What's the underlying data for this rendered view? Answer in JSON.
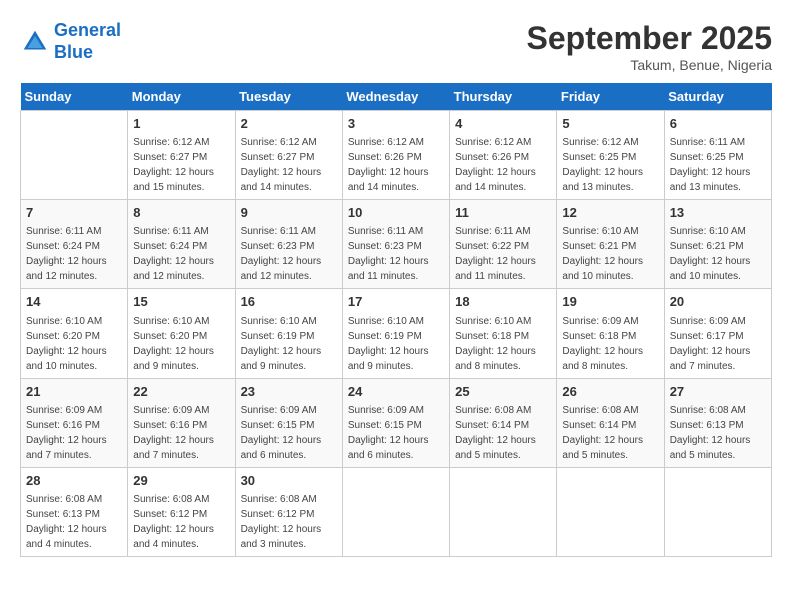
{
  "header": {
    "logo_line1": "General",
    "logo_line2": "Blue",
    "month_title": "September 2025",
    "location": "Takum, Benue, Nigeria"
  },
  "weekdays": [
    "Sunday",
    "Monday",
    "Tuesday",
    "Wednesday",
    "Thursday",
    "Friday",
    "Saturday"
  ],
  "weeks": [
    [
      {
        "day": "",
        "detail": ""
      },
      {
        "day": "1",
        "detail": "Sunrise: 6:12 AM\nSunset: 6:27 PM\nDaylight: 12 hours\nand 15 minutes."
      },
      {
        "day": "2",
        "detail": "Sunrise: 6:12 AM\nSunset: 6:27 PM\nDaylight: 12 hours\nand 14 minutes."
      },
      {
        "day": "3",
        "detail": "Sunrise: 6:12 AM\nSunset: 6:26 PM\nDaylight: 12 hours\nand 14 minutes."
      },
      {
        "day": "4",
        "detail": "Sunrise: 6:12 AM\nSunset: 6:26 PM\nDaylight: 12 hours\nand 14 minutes."
      },
      {
        "day": "5",
        "detail": "Sunrise: 6:12 AM\nSunset: 6:25 PM\nDaylight: 12 hours\nand 13 minutes."
      },
      {
        "day": "6",
        "detail": "Sunrise: 6:11 AM\nSunset: 6:25 PM\nDaylight: 12 hours\nand 13 minutes."
      }
    ],
    [
      {
        "day": "7",
        "detail": "Sunrise: 6:11 AM\nSunset: 6:24 PM\nDaylight: 12 hours\nand 12 minutes."
      },
      {
        "day": "8",
        "detail": "Sunrise: 6:11 AM\nSunset: 6:24 PM\nDaylight: 12 hours\nand 12 minutes."
      },
      {
        "day": "9",
        "detail": "Sunrise: 6:11 AM\nSunset: 6:23 PM\nDaylight: 12 hours\nand 12 minutes."
      },
      {
        "day": "10",
        "detail": "Sunrise: 6:11 AM\nSunset: 6:23 PM\nDaylight: 12 hours\nand 11 minutes."
      },
      {
        "day": "11",
        "detail": "Sunrise: 6:11 AM\nSunset: 6:22 PM\nDaylight: 12 hours\nand 11 minutes."
      },
      {
        "day": "12",
        "detail": "Sunrise: 6:10 AM\nSunset: 6:21 PM\nDaylight: 12 hours\nand 10 minutes."
      },
      {
        "day": "13",
        "detail": "Sunrise: 6:10 AM\nSunset: 6:21 PM\nDaylight: 12 hours\nand 10 minutes."
      }
    ],
    [
      {
        "day": "14",
        "detail": "Sunrise: 6:10 AM\nSunset: 6:20 PM\nDaylight: 12 hours\nand 10 minutes."
      },
      {
        "day": "15",
        "detail": "Sunrise: 6:10 AM\nSunset: 6:20 PM\nDaylight: 12 hours\nand 9 minutes."
      },
      {
        "day": "16",
        "detail": "Sunrise: 6:10 AM\nSunset: 6:19 PM\nDaylight: 12 hours\nand 9 minutes."
      },
      {
        "day": "17",
        "detail": "Sunrise: 6:10 AM\nSunset: 6:19 PM\nDaylight: 12 hours\nand 9 minutes."
      },
      {
        "day": "18",
        "detail": "Sunrise: 6:10 AM\nSunset: 6:18 PM\nDaylight: 12 hours\nand 8 minutes."
      },
      {
        "day": "19",
        "detail": "Sunrise: 6:09 AM\nSunset: 6:18 PM\nDaylight: 12 hours\nand 8 minutes."
      },
      {
        "day": "20",
        "detail": "Sunrise: 6:09 AM\nSunset: 6:17 PM\nDaylight: 12 hours\nand 7 minutes."
      }
    ],
    [
      {
        "day": "21",
        "detail": "Sunrise: 6:09 AM\nSunset: 6:16 PM\nDaylight: 12 hours\nand 7 minutes."
      },
      {
        "day": "22",
        "detail": "Sunrise: 6:09 AM\nSunset: 6:16 PM\nDaylight: 12 hours\nand 7 minutes."
      },
      {
        "day": "23",
        "detail": "Sunrise: 6:09 AM\nSunset: 6:15 PM\nDaylight: 12 hours\nand 6 minutes."
      },
      {
        "day": "24",
        "detail": "Sunrise: 6:09 AM\nSunset: 6:15 PM\nDaylight: 12 hours\nand 6 minutes."
      },
      {
        "day": "25",
        "detail": "Sunrise: 6:08 AM\nSunset: 6:14 PM\nDaylight: 12 hours\nand 5 minutes."
      },
      {
        "day": "26",
        "detail": "Sunrise: 6:08 AM\nSunset: 6:14 PM\nDaylight: 12 hours\nand 5 minutes."
      },
      {
        "day": "27",
        "detail": "Sunrise: 6:08 AM\nSunset: 6:13 PM\nDaylight: 12 hours\nand 5 minutes."
      }
    ],
    [
      {
        "day": "28",
        "detail": "Sunrise: 6:08 AM\nSunset: 6:13 PM\nDaylight: 12 hours\nand 4 minutes."
      },
      {
        "day": "29",
        "detail": "Sunrise: 6:08 AM\nSunset: 6:12 PM\nDaylight: 12 hours\nand 4 minutes."
      },
      {
        "day": "30",
        "detail": "Sunrise: 6:08 AM\nSunset: 6:12 PM\nDaylight: 12 hours\nand 3 minutes."
      },
      {
        "day": "",
        "detail": ""
      },
      {
        "day": "",
        "detail": ""
      },
      {
        "day": "",
        "detail": ""
      },
      {
        "day": "",
        "detail": ""
      }
    ]
  ]
}
